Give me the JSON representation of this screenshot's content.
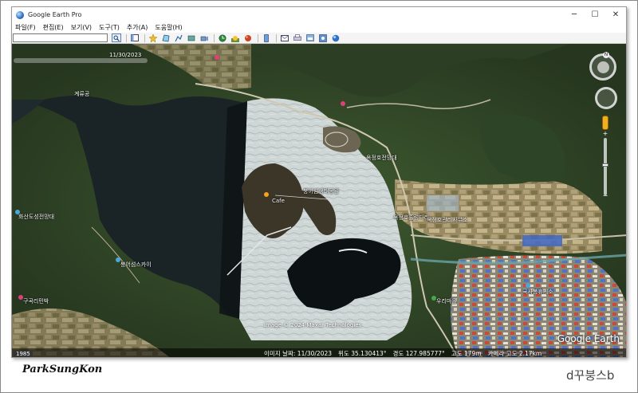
{
  "window": {
    "title": "Google Earth Pro",
    "controls": [
      "─",
      "☐",
      "✕"
    ]
  },
  "menu": [
    "파일(F)",
    "편집(E)",
    "보기(V)",
    "도구(T)",
    "추가(A)",
    "도움말(H)"
  ],
  "toolbar": {
    "search_icon": "search-icon",
    "buttons": [
      "sidebar-icon",
      "placemark-icon",
      "polygon-icon",
      "path-icon",
      "image-overlay-icon",
      "record-tour-icon",
      "historical-imagery-icon",
      "sun-icon",
      "planets-icon",
      "ruler-icon",
      "email-icon",
      "print-icon",
      "save-image-icon",
      "maps-icon",
      "earth-gallery-icon"
    ]
  },
  "time_slider": {
    "date": "11/30/2023"
  },
  "map_labels": [
    {
      "text": "계류공"
    },
    {
      "text": "붕어섬생태공원"
    },
    {
      "text": "옥정호전망대"
    },
    {
      "text": "옥정호출렁다리"
    },
    {
      "text": "화산도성전망대"
    },
    {
      "text": "붕어섬스카이"
    },
    {
      "text": "국사봉휴게소"
    },
    {
      "text": "구곡리민박"
    },
    {
      "text": "옥정호관리사무소"
    },
    {
      "text": "우리마을"
    },
    {
      "text": "Cafe"
    }
  ],
  "credit": "Image © 2024 Maxar Technologies",
  "logo": "Google Earth",
  "year_badge": "1985",
  "status": {
    "date": "이미지 날짜: 11/30/2023",
    "lat": "위도   35.130413°",
    "lon": "경도  127.985777°",
    "elev": "고도   179m",
    "eye": "카메라 고도  2.17km"
  },
  "nav": {
    "north": "N"
  },
  "signature_left": "ParkSungKon",
  "signature_right": "d꾸붕스b"
}
